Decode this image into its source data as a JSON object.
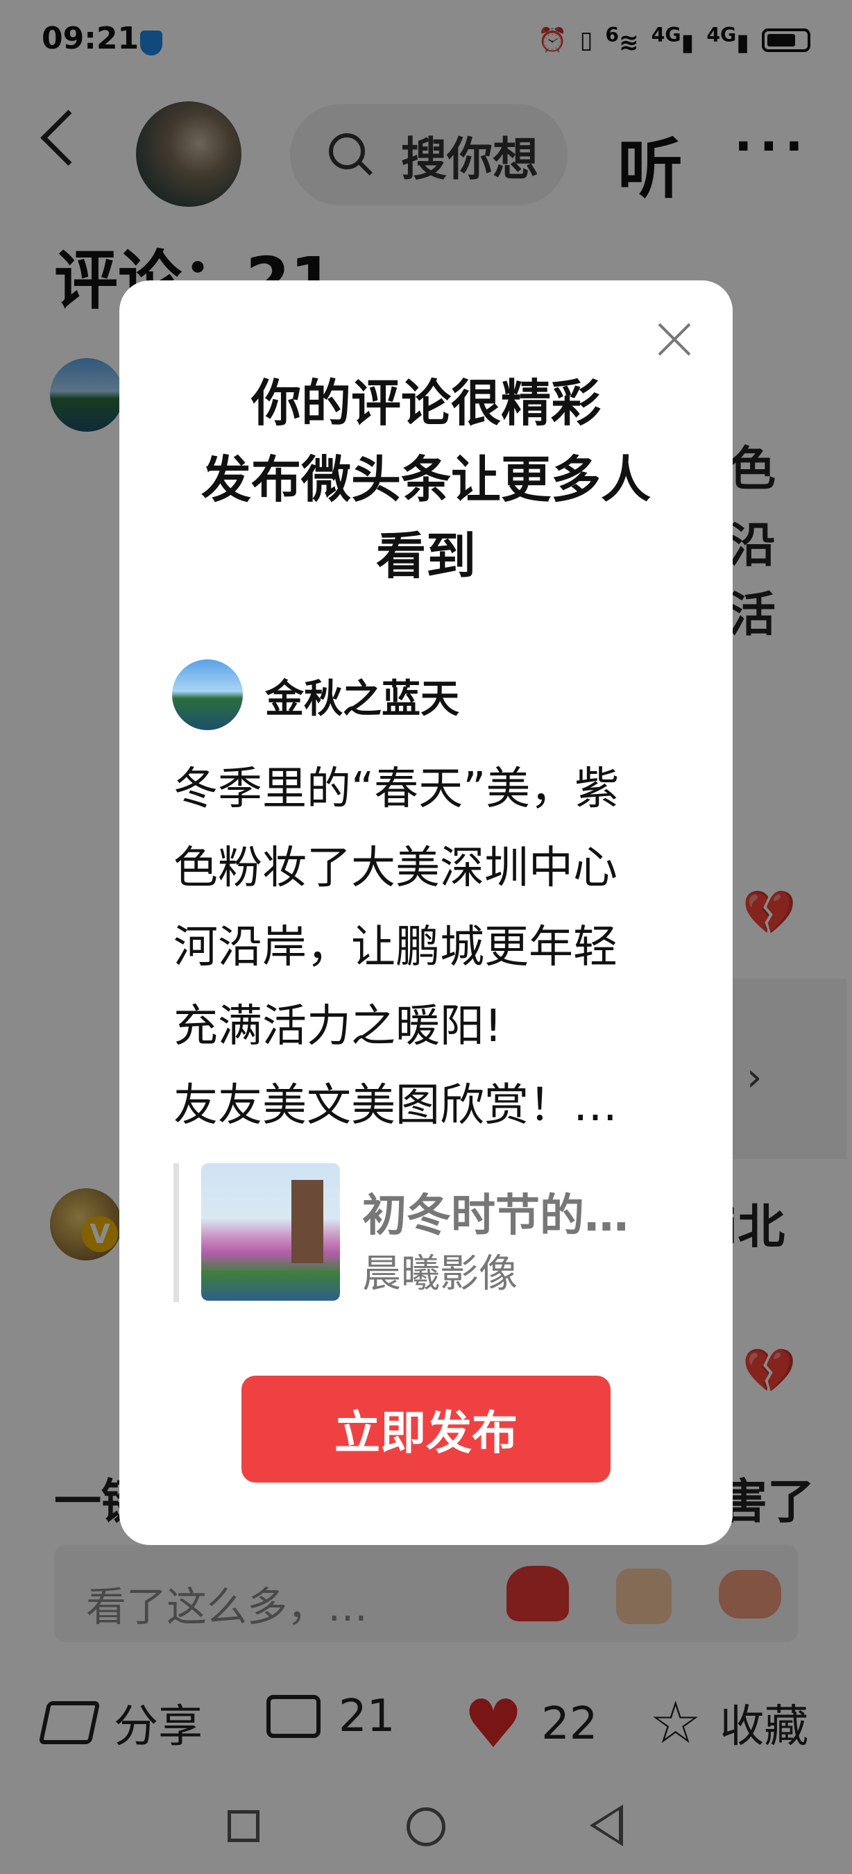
{
  "status_bar": {
    "time": "09:21",
    "icons": [
      "alarm-icon",
      "vibrate-icon",
      "wifi-6-icon",
      "signal-4g-icon",
      "signal-4g-icon",
      "battery-icon"
    ],
    "net_label_1": "4G",
    "net_label_2": "4G",
    "wifi_label": "6"
  },
  "header": {
    "search_placeholder": "搜你想",
    "listen_label": "听",
    "more_label": "···"
  },
  "comments": {
    "title": "评论：21",
    "bg_fragments": [
      "色",
      "沿",
      "活",
      "i北",
      "一键",
      "厉害了"
    ]
  },
  "input_bar": {
    "placeholder": "看了这么多，…"
  },
  "bottom_bar": {
    "share_label": "分享",
    "comment_count": "21",
    "like_count": "22",
    "favorite_label": "收藏"
  },
  "modal": {
    "title_line1": "你的评论很精彩",
    "title_line2": "发布微头条让更多人",
    "title_line3": "看到",
    "username": "金秋之蓝天",
    "post_lines": [
      "冬季里的“春天”美，紫",
      "色粉妆了大美深圳中心",
      "河沿岸，让鹏城更年轻",
      "充满活力之暖阳!",
      "友友美文美图欣赏！…"
    ],
    "article_title": "初冬时节的…",
    "article_source": "晨曦影像",
    "publish_button": "立即发布"
  },
  "colors": {
    "accent": "#f04142",
    "like_heart": "#e02727",
    "overlay": "rgba(0,0,0,0.46)"
  }
}
